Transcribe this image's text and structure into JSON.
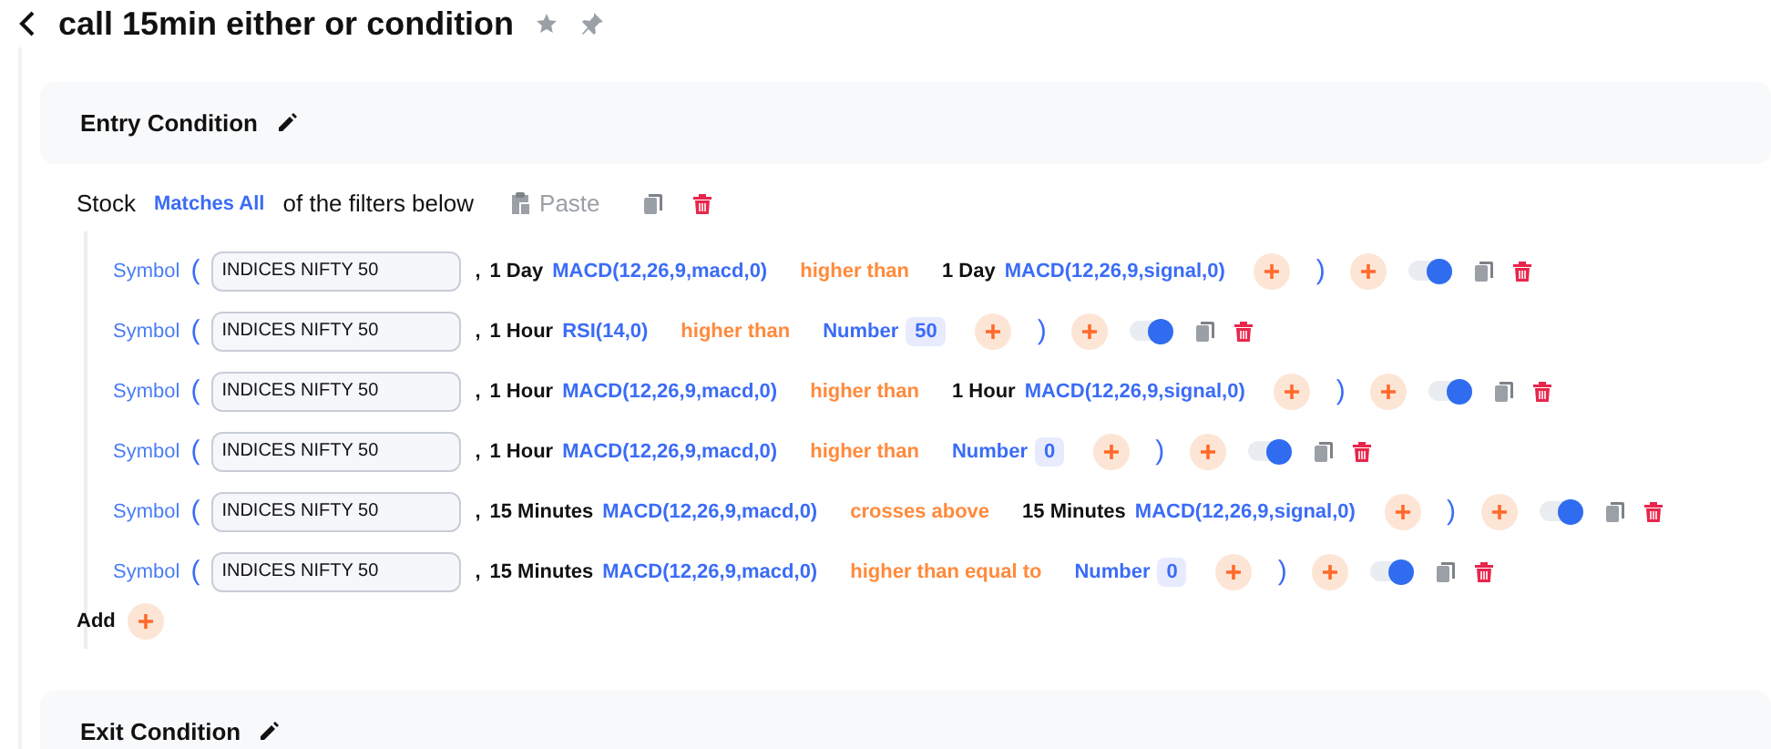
{
  "header": {
    "title": "call 15min either or condition"
  },
  "entry": {
    "title": "Entry Condition",
    "stock": "Stock",
    "match": "Matches All",
    "suffix": "of the filters below",
    "paste": "Paste",
    "rows": [
      {
        "label": "Symbol",
        "open": "(",
        "symbol": "INDICES NIFTY 50",
        "comma": ",",
        "timeframe": "1 Day",
        "indicator": "MACD(12,26,9,macd,0)",
        "operator": "higher than",
        "right": {
          "kind": "indicator",
          "timeframe": "1 Day",
          "indicator": "MACD(12,26,9,signal,0)"
        },
        "close": ")",
        "on": true
      },
      {
        "label": "Symbol",
        "open": "(",
        "symbol": "INDICES NIFTY 50",
        "comma": ",",
        "timeframe": "1 Hour",
        "indicator": "RSI(14,0)",
        "operator": "higher than",
        "right": {
          "kind": "number",
          "label": "Number",
          "value": "50"
        },
        "close": ")",
        "on": true
      },
      {
        "label": "Symbol",
        "open": "(",
        "symbol": "INDICES NIFTY 50",
        "comma": ",",
        "timeframe": "1 Hour",
        "indicator": "MACD(12,26,9,macd,0)",
        "operator": "higher than",
        "right": {
          "kind": "indicator",
          "timeframe": "1 Hour",
          "indicator": "MACD(12,26,9,signal,0)"
        },
        "close": ")",
        "on": true
      },
      {
        "label": "Symbol",
        "open": "(",
        "symbol": "INDICES NIFTY 50",
        "comma": ",",
        "timeframe": "1 Hour",
        "indicator": "MACD(12,26,9,macd,0)",
        "operator": "higher than",
        "right": {
          "kind": "number",
          "label": "Number",
          "value": "0"
        },
        "close": ")",
        "on": true
      },
      {
        "label": "Symbol",
        "open": "(",
        "symbol": "INDICES NIFTY 50",
        "comma": ",",
        "timeframe": "15 Minutes",
        "indicator": "MACD(12,26,9,macd,0)",
        "operator": "crosses above",
        "right": {
          "kind": "indicator",
          "timeframe": "15 Minutes",
          "indicator": "MACD(12,26,9,signal,0)"
        },
        "close": ")",
        "on": true
      },
      {
        "label": "Symbol",
        "open": "(",
        "symbol": "INDICES NIFTY 50",
        "comma": ",",
        "timeframe": "15 Minutes",
        "indicator": "MACD(12,26,9,macd,0)",
        "operator": "higher than equal to",
        "right": {
          "kind": "number",
          "label": "Number",
          "value": "0"
        },
        "close": ")",
        "on": true
      }
    ],
    "add": "Add"
  },
  "exit": {
    "title": "Exit Condition"
  }
}
